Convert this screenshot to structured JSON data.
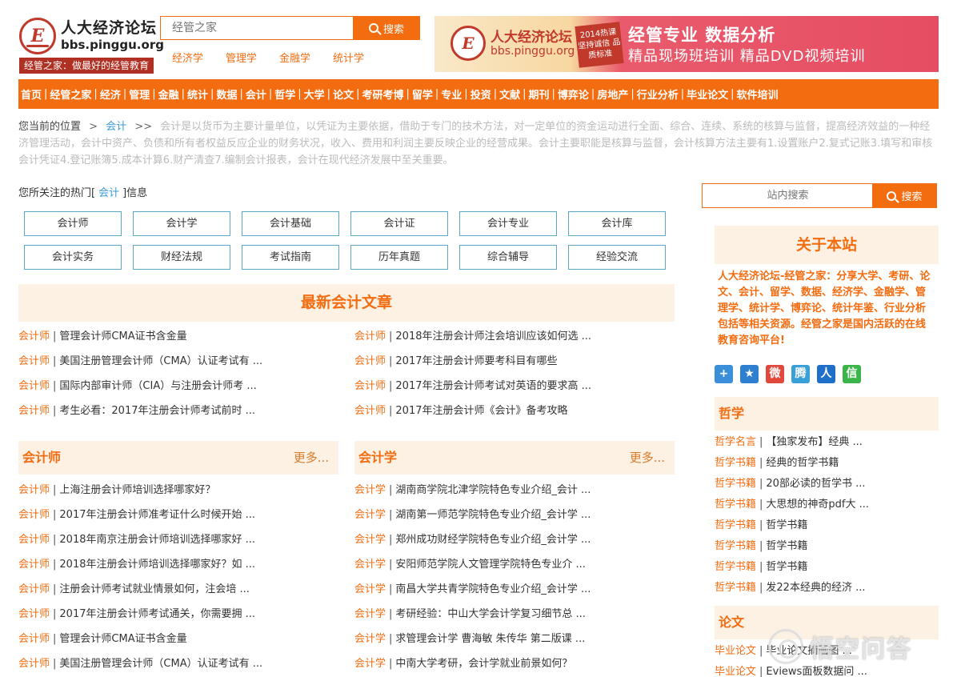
{
  "logo": {
    "mark": "E",
    "name": "人大经济论坛",
    "domain": "bbs.pinggu.org",
    "slogan": "经管之家：做最好的经管教育"
  },
  "top_search": {
    "placeholder": "经管之家",
    "button": "搜索"
  },
  "top_links": [
    "经济学",
    "管理学",
    "金融学",
    "统计学"
  ],
  "banner": {
    "mark": "E",
    "name": "人大经济论坛",
    "domain": "bbs.pinggu.org",
    "tag": "2014热课 坚持诚信 品质标准",
    "headline": "经管专业 数据分析",
    "sub": "精品现场班培训   精品DVD视频培训"
  },
  "nav": [
    "首页",
    "经管之家",
    "经济",
    "管理",
    "金融",
    "统计",
    "数据",
    "会计",
    "哲学",
    "大学",
    "论文",
    "考研考博",
    "留学",
    "专业",
    "投资",
    "文献",
    "期刊",
    "博弈论",
    "房地产",
    "行业分析",
    "毕业论文",
    "软件培训"
  ],
  "breadcrumb": {
    "lead": "您当前的位置",
    "arrow1": ">",
    "current": "会计",
    "arrow2": ">>",
    "description": "会计是以货币为主要计量单位，以凭证为主要依据，借助于专门的技术方法，对一定单位的资金运动进行全面、综合、连续、系统的核算与监督，提高经济效益的一种经济管理活动，会计中资产、负债和所有者权益反应企业的财务状况，收入、费用和利润主要反映企业的经营成果。会计主要职能是核算与监督，会计核算方法主要有1.设置账户2.复式记账3.填写和审核会计凭证4.登记账簿5.成本计算6.财产清查7.编制会计报表，会计在现代经济发展中至关重要。"
  },
  "hot": {
    "prefix": "您所关注的热门[",
    "keyword": "会计",
    "suffix": "]信息",
    "tags": [
      "会计师",
      "会计学",
      "会计基础",
      "会计证",
      "会计专业",
      "会计库",
      "会计实务",
      "财经法规",
      "考试指南",
      "历年真题",
      "综合辅导",
      "经验交流"
    ]
  },
  "latest": {
    "title": "最新会计文章",
    "left": [
      {
        "cat": "会计师",
        "title": "管理会计师CMA证书含金量"
      },
      {
        "cat": "会计师",
        "title": "美国注册管理会计师（CMA）认证考试有 ..."
      },
      {
        "cat": "会计师",
        "title": "国际内部审计师（CIA）与注册会计师考 ..."
      },
      {
        "cat": "会计师",
        "title": "考生必看：2017年注册会计师考试前时 ..."
      }
    ],
    "right": [
      {
        "cat": "会计师",
        "title": "2018年注册会计师注会培训应该如何选 ..."
      },
      {
        "cat": "会计师",
        "title": "2017年注册会计师要考科目有哪些"
      },
      {
        "cat": "会计师",
        "title": "2017年注册会计师考试对英语的要求高 ..."
      },
      {
        "cat": "会计师",
        "title": "2017年注册会计师《会计》备考攻略"
      }
    ]
  },
  "section_accountant": {
    "title": "会计师",
    "more": "更多...",
    "items": [
      {
        "cat": "会计师",
        "title": "上海注册会计师培训选择哪家好？"
      },
      {
        "cat": "会计师",
        "title": "2017年注册会计师准考证什么时候开始 ..."
      },
      {
        "cat": "会计师",
        "title": "2018年南京注册会计师培训选择哪家好 ..."
      },
      {
        "cat": "会计师",
        "title": "2018年注册会计师培训选择哪家好？如 ..."
      },
      {
        "cat": "会计师",
        "title": "注册会计师考试就业情景如何，注会培 ..."
      },
      {
        "cat": "会计师",
        "title": "2017年注册会计师考试通关，你需要拥 ..."
      },
      {
        "cat": "会计师",
        "title": "管理会计师CMA证书含金量"
      },
      {
        "cat": "会计师",
        "title": "美国注册管理会计师（CMA）认证考试有 ..."
      }
    ]
  },
  "section_accounting": {
    "title": "会计学",
    "more": "更多...",
    "items": [
      {
        "cat": "会计学",
        "title": "湖南商学院北津学院特色专业介绍_会计 ..."
      },
      {
        "cat": "会计学",
        "title": "湖南第一师范学院特色专业介绍_会计学 ..."
      },
      {
        "cat": "会计学",
        "title": "郑州成功财经学院特色专业介绍_会计学 ..."
      },
      {
        "cat": "会计学",
        "title": "安阳师范学院人文管理学院特色专业介 ..."
      },
      {
        "cat": "会计学",
        "title": "南昌大学共青学院特色专业介绍_会计学 ..."
      },
      {
        "cat": "会计学",
        "title": "考研经验：中山大学会计学复习细节总 ..."
      },
      {
        "cat": "会计学",
        "title": "求管理会计学 曹海敏 朱传华 第二版课 ..."
      },
      {
        "cat": "会计学",
        "title": "中南大学考研，会计学就业前景如何？"
      }
    ]
  },
  "side_search": {
    "placeholder": "站内搜索",
    "button": "搜索"
  },
  "about": {
    "title": "关于本站",
    "text": "人大经济论坛-经管之家：分享大学、考研、论文、会计、留学、数据、经济学、金融学、管理学、统计学、博弈论、统计年鉴、行业分析包括等相关资源。经管之家是国内活跃的在线教育咨询平台!"
  },
  "share_icons": [
    {
      "name": "add-share-icon",
      "glyph": "+",
      "color": "#3b8fd8"
    },
    {
      "name": "star-share-icon",
      "glyph": "★",
      "color": "#2f7fd0"
    },
    {
      "name": "weibo-share-icon",
      "glyph": "微",
      "color": "#e0483b"
    },
    {
      "name": "tencent-weibo-share-icon",
      "glyph": "腾",
      "color": "#3aa0d8"
    },
    {
      "name": "renren-share-icon",
      "glyph": "人",
      "color": "#1f6ec8"
    },
    {
      "name": "wechat-share-icon",
      "glyph": "信",
      "color": "#3bb54a"
    }
  ],
  "philosophy": {
    "title": "哲学",
    "items": [
      {
        "cat": "哲学名言",
        "title": "【独家发布】经典 ..."
      },
      {
        "cat": "哲学书籍",
        "title": "经典的哲学书籍"
      },
      {
        "cat": "哲学书籍",
        "title": "20部必读的哲学书 ..."
      },
      {
        "cat": "哲学书籍",
        "title": "大思想的神奇pdf大 ..."
      },
      {
        "cat": "哲学书籍",
        "title": "哲学书籍"
      },
      {
        "cat": "哲学书籍",
        "title": "哲学书籍"
      },
      {
        "cat": "哲学书籍",
        "title": "哲学书籍"
      },
      {
        "cat": "哲学书籍",
        "title": "发22本经典的经济 ..."
      }
    ]
  },
  "thesis": {
    "title": "论文",
    "items": [
      {
        "cat": "毕业论文",
        "title": "毕业论文摘画图 ..."
      },
      {
        "cat": "毕业论文",
        "title": "Eviews面板数据问 ..."
      }
    ]
  },
  "watermark": {
    "text": "悟空问答"
  }
}
